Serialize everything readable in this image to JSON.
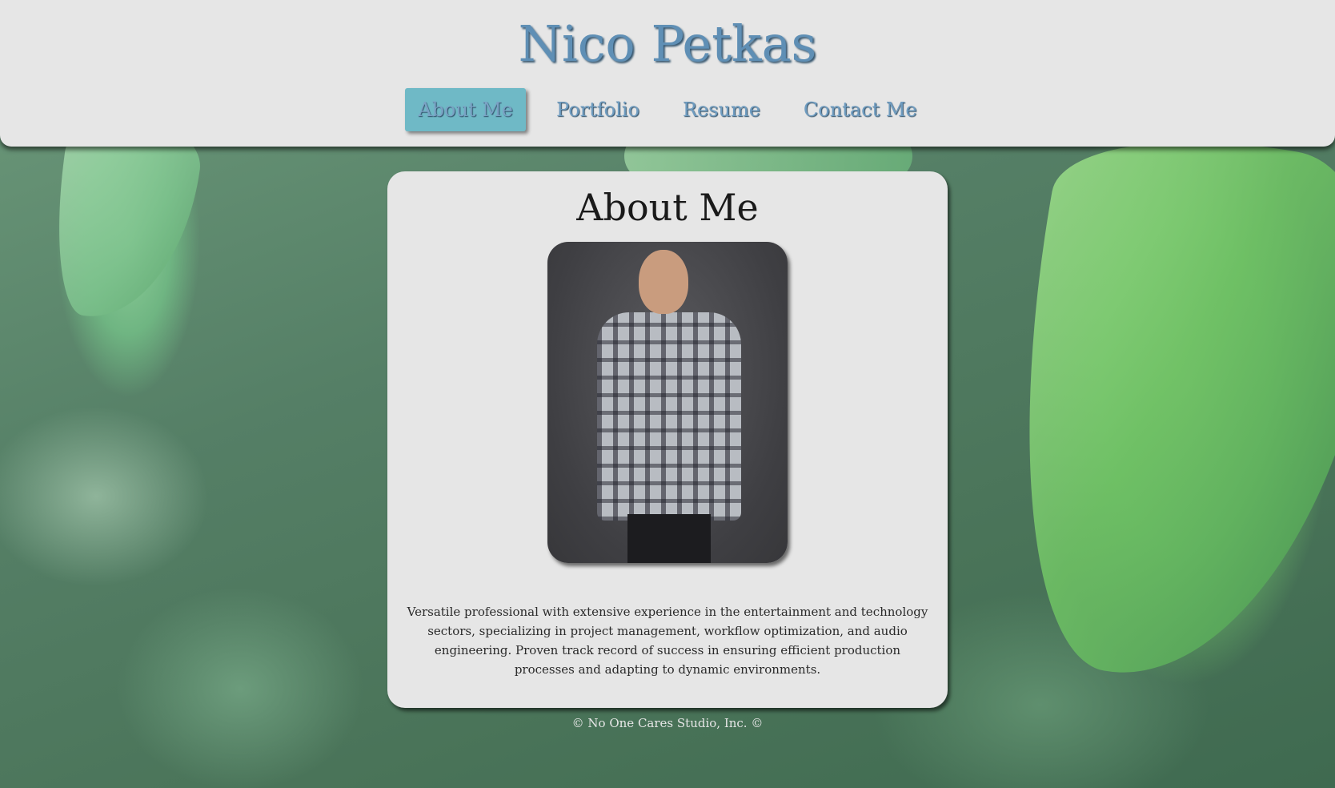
{
  "site": {
    "title": "Nico Petkas"
  },
  "nav": {
    "items": [
      {
        "label": "About Me",
        "active": true
      },
      {
        "label": "Portfolio",
        "active": false
      },
      {
        "label": "Resume",
        "active": false
      },
      {
        "label": "Contact Me",
        "active": false
      }
    ]
  },
  "about": {
    "heading": "About Me",
    "photo": "portrait-photo",
    "bio": "Versatile professional with extensive experience in the entertainment and technology sectors, specializing in project management, workflow optimization, and audio engineering. Proven track record of success in ensuring efficient production processes and adapting to dynamic environments."
  },
  "footer": {
    "text": "© No One Cares Studio, Inc. ©"
  },
  "colors": {
    "accent": "#6fb9c6",
    "title": "#5f8fb5",
    "panel": "#e6e6e6"
  }
}
